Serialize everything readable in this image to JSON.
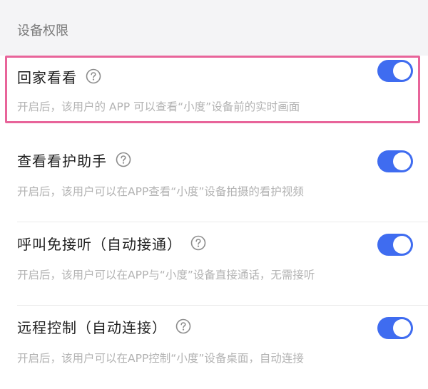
{
  "section": {
    "title": "设备权限"
  },
  "permissions": [
    {
      "title": "回家看看",
      "description": "开启后，该用户的 APP 可以查看“小度”设备前的实时画面",
      "enabled": true,
      "highlighted": true
    },
    {
      "title": "查看看护助手",
      "description": "开启后，该用户可以在APP查看“小度”设备拍摄的看护视频",
      "enabled": true,
      "highlighted": false
    },
    {
      "title": "呼叫免接听（自动接通）",
      "description": "开启后，该用户可以在APP与“小度”设备直接通话，无需接听",
      "enabled": true,
      "highlighted": false
    },
    {
      "title": "远程控制（自动连接）",
      "description": "开启后，该用户可以在APP控制“小度”设备桌面，自动连接",
      "enabled": true,
      "highlighted": false
    }
  ],
  "icons": {
    "help": "question-circle-icon"
  },
  "colors": {
    "toggle_on": "#3f6cf0",
    "highlight_border": "#e8649a",
    "header_bg": "#f4f4f6",
    "description_text": "#b3b3b3"
  }
}
